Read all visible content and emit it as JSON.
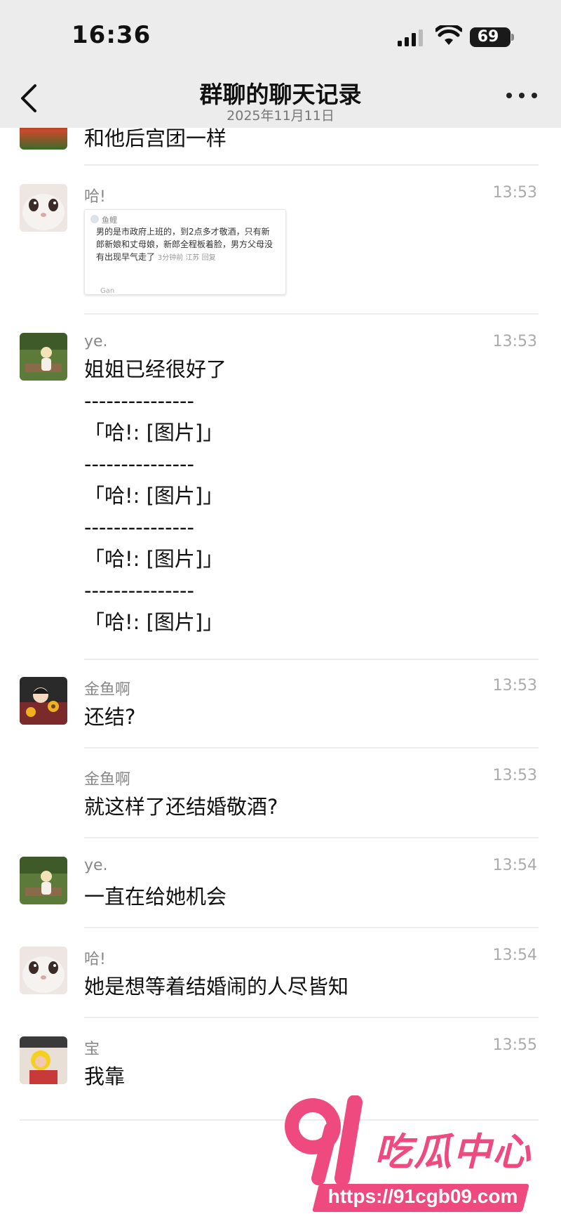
{
  "status_bar": {
    "time": "16:36",
    "battery": "69"
  },
  "nav": {
    "title": "群聊的聊天记录",
    "subtitle": "2025年11月11日"
  },
  "partial_message": {
    "text": "和他后宫团一样"
  },
  "messages": [
    {
      "sender": "哈!",
      "time": "13:53",
      "avatar": "cat-face"
    },
    {
      "sender": "ye.",
      "time": "13:53",
      "avatar": "person-outdoor",
      "lines": [
        "姐姐已经很好了",
        "---------------",
        "「哈!: [图片]」",
        "---------------",
        "「哈!: [图片]」",
        "---------------",
        "「哈!: [图片]」",
        "---------------",
        "「哈!: [图片]」"
      ]
    },
    {
      "sender": "金鱼啊",
      "time": "13:53",
      "avatar": "cartoon-sunflower",
      "text": "还结?"
    },
    {
      "sender": "金鱼啊",
      "time": "13:53",
      "text": "就这样了还结婚敬酒?"
    },
    {
      "sender": "ye.",
      "time": "13:54",
      "avatar": "person-outdoor",
      "text": "一直在给她机会"
    },
    {
      "sender": "哈!",
      "time": "13:54",
      "avatar": "cat-face",
      "text": "她是想等着结婚闹的人尽皆知"
    },
    {
      "sender": "宝",
      "time": "13:55",
      "avatar": "child-photo",
      "text": "我靠"
    }
  ],
  "embedded_image": {
    "user": "鱼鲤",
    "body": "男的是市政府上班的，到2点多才敬酒，只有新郎新娘和丈母娘，新郎全程板着脸，男方父母没有出现早气走了",
    "meta": "3分钟前 江苏 回复",
    "next": "Gan"
  },
  "watermark": {
    "brand": "91吃瓜中心",
    "url": "https://91cgb09.com"
  },
  "colors": {
    "topbar": "#ececec",
    "watermark": "#ef4a80",
    "divider": "#ececec"
  }
}
